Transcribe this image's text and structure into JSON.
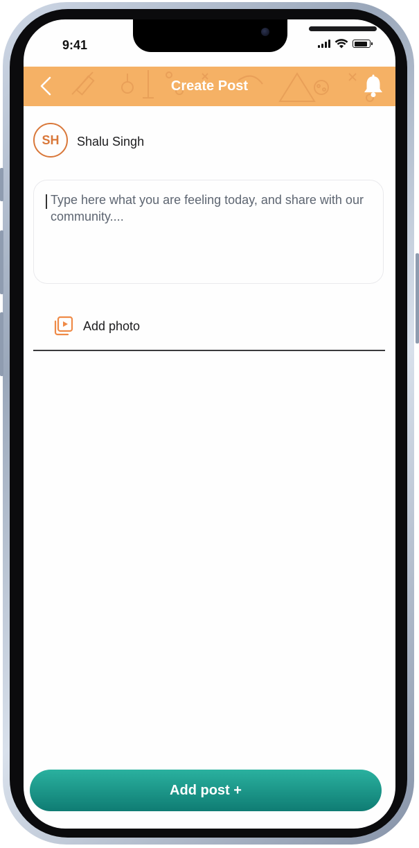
{
  "status_bar": {
    "time": "9:41"
  },
  "header": {
    "title": "Create Post"
  },
  "user": {
    "initials": "SH",
    "name": "Shalu Singh"
  },
  "composer": {
    "value": "",
    "placeholder": "Type here what you are feeling today, and share with our community...."
  },
  "add_photo": {
    "label": "Add photo",
    "icon": "photo-play-icon"
  },
  "add_post_button": {
    "label": "Add post +"
  },
  "colors": {
    "header": "#f5b165",
    "accent": "#d9783a",
    "button_top": "#2ab19f",
    "button_bottom": "#0f7c73"
  }
}
